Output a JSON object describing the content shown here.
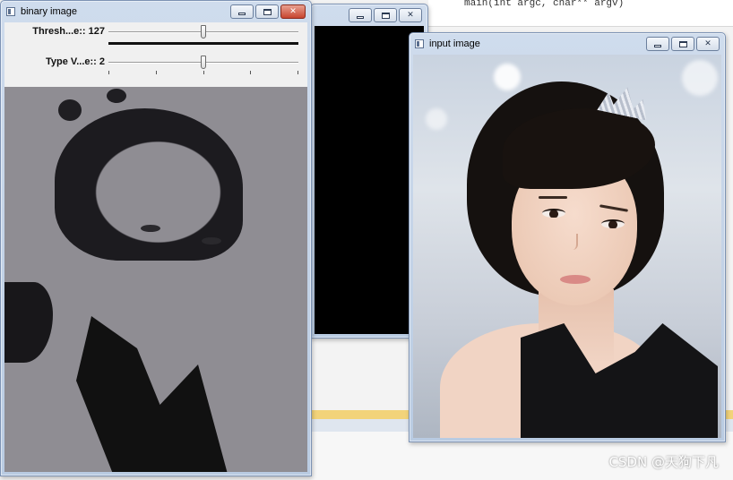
{
  "background": {
    "editor_code_line": "main(int argc, char** argv)"
  },
  "windows": {
    "binary": {
      "title": "binary image",
      "trackbars": [
        {
          "label": "Thresh...e:: 127",
          "value": 127,
          "max": 255
        },
        {
          "label": "Type V...e:: 2",
          "value": 2,
          "max": 4
        }
      ],
      "buttons": {
        "minimize": "minimize",
        "maximize": "maximize",
        "close": "✕"
      }
    },
    "black": {
      "title": "",
      "buttons": {
        "minimize": "minimize",
        "maximize": "maximize",
        "close": "✕"
      }
    },
    "input": {
      "title": "input image",
      "buttons": {
        "minimize": "minimize",
        "maximize": "maximize",
        "close": "✕"
      }
    }
  },
  "watermark": "CSDN @天狗下凡",
  "colors": {
    "title_gradient_top": "#cfdced",
    "close_button": "#c7452f",
    "binary_background": "#8f8d93"
  }
}
